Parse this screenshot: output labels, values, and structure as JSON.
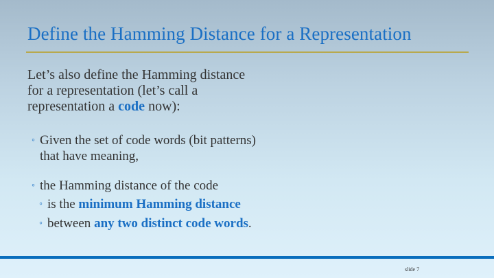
{
  "slide": {
    "title": "Define the Hamming Distance for a Representation",
    "intro": {
      "line1": "Let’s also define the Hamming distance",
      "line2": "for a representation (let’s call a",
      "line3_pre": "representation a ",
      "line3_highlight": "code",
      "line3_post": " now):"
    },
    "bullets": {
      "b1_line1": "Given the set of code words (bit patterns)",
      "b1_line2": "that have meaning,",
      "b2": "the Hamming distance of the code",
      "b3_pre": "is the ",
      "b3_highlight": "minimum Hamming distance",
      "b4_pre": "between ",
      "b4_highlight": "any two distinct code words",
      "b4_post": "."
    },
    "bullet_marker": "◦",
    "slide_number": "slide 7"
  },
  "colors": {
    "accent": "#1a6fc4",
    "rule": "#b8a94e",
    "bottom_bar": "#0a6ebd"
  }
}
